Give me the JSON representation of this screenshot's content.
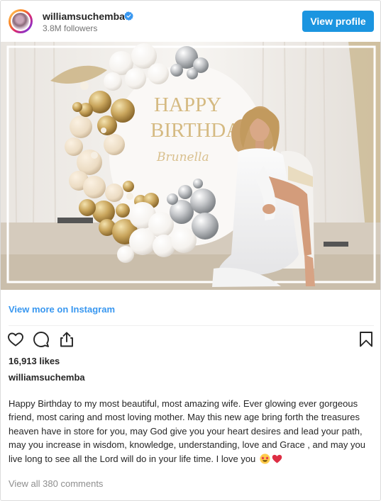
{
  "header": {
    "username": "williamsuchemba",
    "followers": "3.8M followers",
    "view_profile_label": "View profile"
  },
  "photo": {
    "backdrop_line1": "HAPPY",
    "backdrop_line2": "BIRTHDAY",
    "backdrop_name": "Brunella"
  },
  "links": {
    "view_more": "View more on Instagram"
  },
  "actions": {
    "icons": [
      "heart-icon",
      "comment-icon",
      "share-icon",
      "bookmark-icon"
    ]
  },
  "post": {
    "likes": "16,913 likes",
    "caption_username": "williamsuchemba",
    "caption_text": "Happy Birthday to my most beautiful, most amazing wife. Ever glowing ever gorgeous friend, most caring and most loving mother. May this new age bring forth the treasures heaven have in store for you, may God give you your heart desires and lead your path, may you increase in wisdom, knowledge, understanding, love and Grace , and may you live long to see all the Lord will do in your life time. I love you",
    "caption_emojis": [
      "star-struck-emoji",
      "red-heart-emoji"
    ],
    "view_all_comments": "View all 380 comments"
  },
  "colors": {
    "accent": "#1b95e0",
    "link": "#3897f0",
    "muted": "#8e8e8e"
  }
}
